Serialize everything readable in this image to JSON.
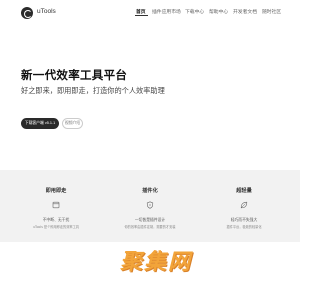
{
  "header": {
    "brand": "uTools",
    "nav": [
      {
        "label": "首页",
        "active": true
      },
      {
        "label": "插件应用市场",
        "active": false
      },
      {
        "label": "下载中心",
        "active": false
      },
      {
        "label": "帮助中心",
        "active": false
      },
      {
        "label": "开发者文档",
        "active": false
      },
      {
        "label": "随时社区",
        "active": false
      }
    ]
  },
  "hero": {
    "title": "新一代效率工具平台",
    "subtitle": "好之即来，即用即走，打造你的个人效率助理",
    "primary_button": "下载客户端 v5.1.1",
    "secondary_button": "视频介绍"
  },
  "features": [
    {
      "title": "即用即走",
      "icon": "window-icon",
      "line1": "不中断、无干扰",
      "line2": "uTools 是个即用即走的效率工具"
    },
    {
      "title": "插件化",
      "icon": "shield-icon",
      "line1": "一切皆是插件设计",
      "line2": "你的效率由插件定制，需要的才安装"
    },
    {
      "title": "超轻量",
      "icon": "leaf-icon",
      "line1": "轻巧而不失强大",
      "line2": "插件平台，极致的轻量化"
    }
  ],
  "watermark": "聚集网",
  "colors": {
    "primary_button": "#2a2a2a",
    "feature_band": "#f2f2f2",
    "watermark": "#f2a43a"
  }
}
